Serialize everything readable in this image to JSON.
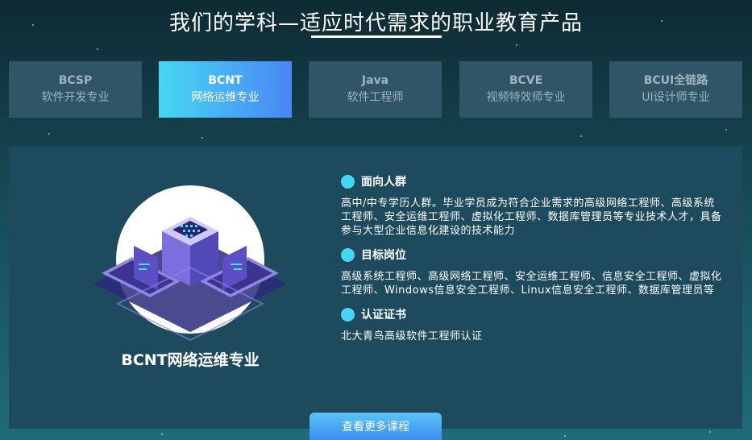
{
  "header": {
    "title": "我们的学科—适应时代需求的职业教育产品"
  },
  "tabs": [
    {
      "code": "BCSP",
      "name": "软件开发专业",
      "active": false
    },
    {
      "code": "BCNT",
      "name": "网络运维专业",
      "active": true
    },
    {
      "code": "Java",
      "name": "软件工程师",
      "active": false
    },
    {
      "code": "BCVE",
      "name": "视频特效师专业",
      "active": false
    },
    {
      "code": "BCUI全链路",
      "name": "UI设计师专业",
      "active": false
    }
  ],
  "panel": {
    "course_title": "BCNT网络运维专业",
    "sections": [
      {
        "title": "面向人群",
        "body": "高中/中专学历人群。毕业学员成为符合企业需求的高级网络工程师、高级系统工程师、安全运维工程师、虚拟化工程师、数据库管理员等专业技术人才，具备参与大型企业信息化建设的技术能力"
      },
      {
        "title": "目标岗位",
        "body": "高级系统工程师、高级网络工程师、安全运维工程师、信息安全工程师、虚拟化工程师、Windows信息安全工程师、Linux信息安全工程师、数据库管理员等"
      },
      {
        "title": "认证证书",
        "body": "北大青鸟高级软件工程师认证"
      }
    ],
    "illustration_icon": "server-network-isometric-icon"
  },
  "more_button": {
    "label": "查看更多课程"
  },
  "colors": {
    "accent": "#45d8f2",
    "accent2": "#4a86f5",
    "panel_bg": "#1e4a5d",
    "tab_bg": "#2f5566"
  }
}
